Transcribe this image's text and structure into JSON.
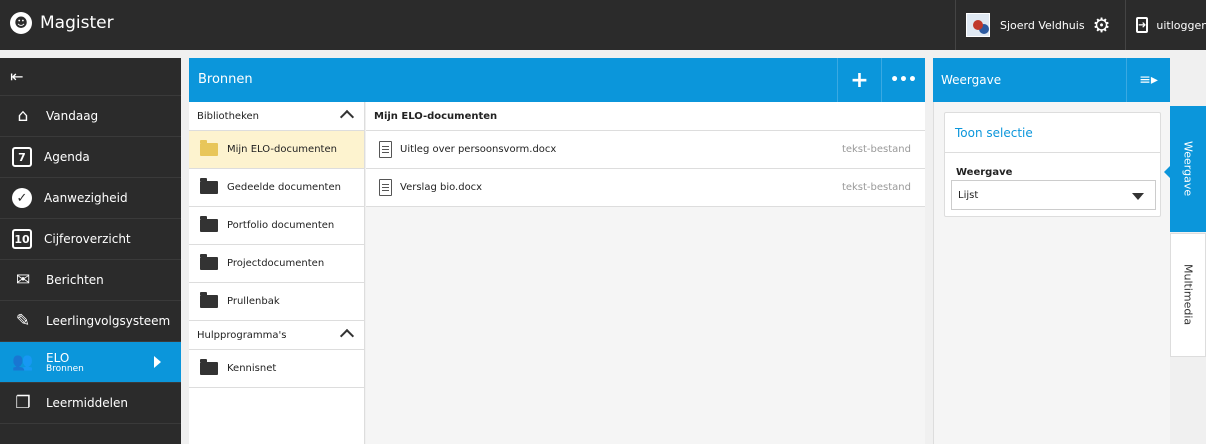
{
  "header": {
    "app_name": "Magister",
    "user_name": "Sjoerd Veldhuis",
    "logout_label": "uitloggen"
  },
  "sidebar": {
    "items": [
      {
        "label": "Vandaag",
        "icon": "home-icon"
      },
      {
        "label": "Agenda",
        "icon": "calendar-icon",
        "glyph": "7"
      },
      {
        "label": "Aanwezigheid",
        "icon": "check-circle-icon"
      },
      {
        "label": "Cijferoverzicht",
        "icon": "grades-icon",
        "glyph": "10"
      },
      {
        "label": "Berichten",
        "icon": "envelope-icon"
      },
      {
        "label": "Leerlingvolgsysteem",
        "icon": "notebook-icon"
      },
      {
        "label": "ELO",
        "sublabel": "Bronnen",
        "icon": "users-icon",
        "active": true
      },
      {
        "label": "Leermiddelen",
        "icon": "books-icon"
      }
    ]
  },
  "main": {
    "title": "Bronnen",
    "libraries": {
      "heading": "Bibliotheken",
      "items": [
        {
          "label": "Mijn ELO-documenten",
          "selected": true
        },
        {
          "label": "Gedeelde documenten"
        },
        {
          "label": "Portfolio documenten"
        },
        {
          "label": "Projectdocumenten"
        },
        {
          "label": "Prullenbak"
        }
      ]
    },
    "tools": {
      "heading": "Hulpprogramma's",
      "items": [
        {
          "label": "Kennisnet"
        }
      ]
    },
    "documents": {
      "heading": "Mijn ELO-documenten",
      "rows": [
        {
          "name": "Uitleg over persoonsvorm.docx",
          "type": "tekst-bestand"
        },
        {
          "name": "Verslag bio.docx",
          "type": "tekst-bestand"
        }
      ]
    }
  },
  "view_panel": {
    "title": "Weergave",
    "card_title": "Toon selectie",
    "field_label": "Weergave",
    "select_value": "Lijst"
  },
  "side_tabs": [
    {
      "label": "Weergave",
      "active": true
    },
    {
      "label": "Multimedia",
      "active": false
    }
  ],
  "colors": {
    "accent": "#0b96db",
    "dark": "#2b2b2b",
    "selected": "#fdf3cf"
  }
}
